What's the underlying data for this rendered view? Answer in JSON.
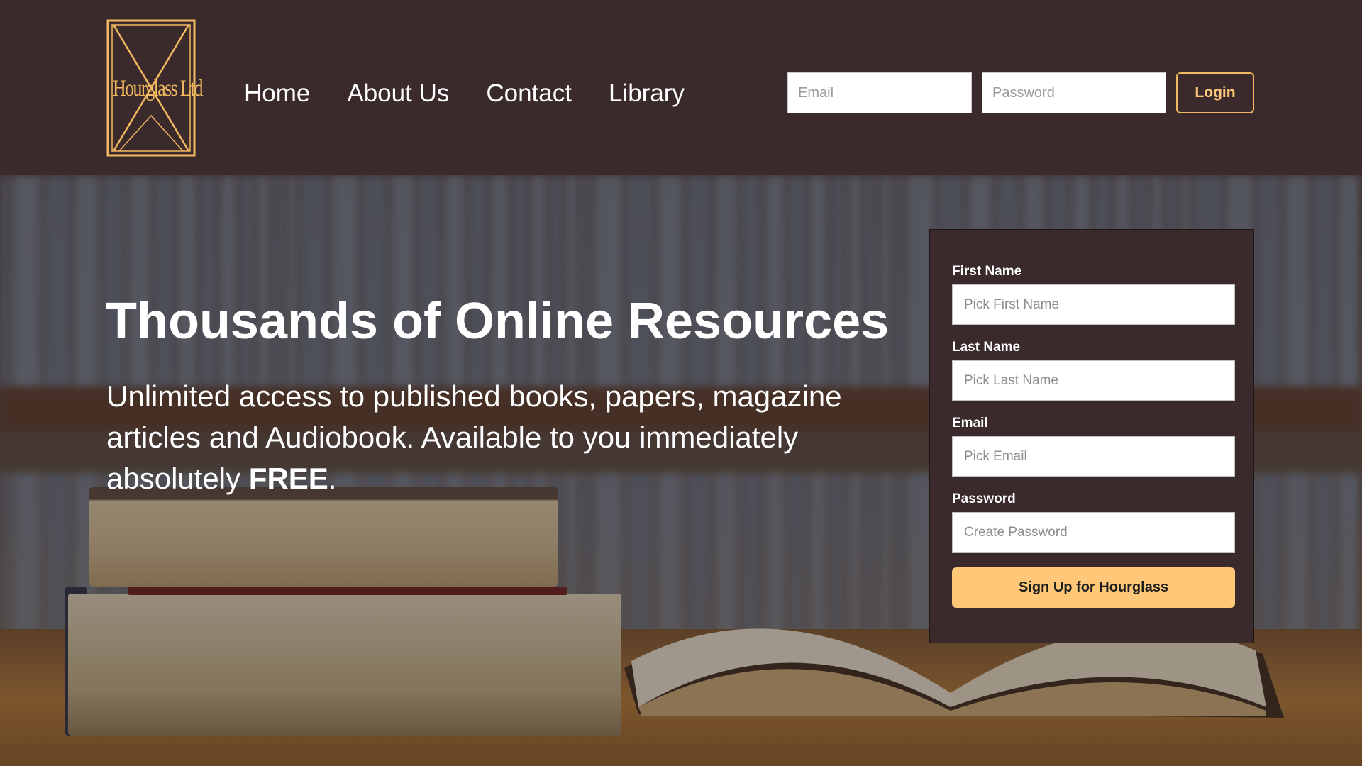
{
  "brand": {
    "logo_text": "Hourglass Ltd",
    "accent_color": "#f2b960",
    "header_bg": "#3a2a2b"
  },
  "nav": {
    "items": [
      {
        "label": "Home"
      },
      {
        "label": "About Us"
      },
      {
        "label": "Contact"
      },
      {
        "label": "Library"
      }
    ]
  },
  "login": {
    "email_placeholder": "Email",
    "password_placeholder": "Password",
    "button_label": "Login"
  },
  "hero": {
    "title": "Thousands of Online Resources",
    "text_before": "Unlimited access to published books, papers, magazine articles and Audiobook. Available to you immediately absolutely ",
    "text_bold": "FREE",
    "text_after": "."
  },
  "signup": {
    "fields": [
      {
        "label": "First Name",
        "placeholder": "Pick First Name"
      },
      {
        "label": "Last Name",
        "placeholder": "Pick Last Name"
      },
      {
        "label": "Email",
        "placeholder": "Pick Email"
      },
      {
        "label": "Password",
        "placeholder": "Create Password"
      }
    ],
    "button_label": "Sign Up for Hourglass",
    "button_color": "#ffc878"
  }
}
